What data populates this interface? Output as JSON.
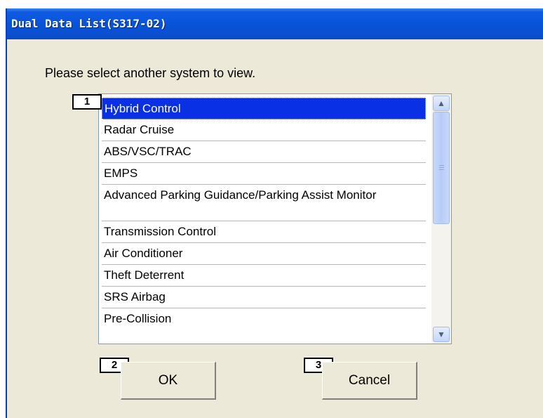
{
  "window": {
    "title": "Dual Data List(S317-02)"
  },
  "instruction": "Please select another system to view.",
  "systems": [
    {
      "label": "Hybrid Control",
      "selected": true
    },
    {
      "label": "Radar Cruise",
      "selected": false
    },
    {
      "label": "ABS/VSC/TRAC",
      "selected": false
    },
    {
      "label": "EMPS",
      "selected": false
    },
    {
      "label": "Advanced Parking Guidance/Parking Assist Monitor",
      "selected": false
    },
    {
      "label": "Transmission Control",
      "selected": false
    },
    {
      "label": "Air Conditioner",
      "selected": false
    },
    {
      "label": "Theft Deterrent",
      "selected": false
    },
    {
      "label": "SRS Airbag",
      "selected": false
    },
    {
      "label": "Pre-Collision",
      "selected": false
    }
  ],
  "callouts": {
    "list": "1",
    "ok": "2",
    "cancel": "3"
  },
  "buttons": {
    "ok": "OK",
    "cancel": "Cancel"
  },
  "icons": {
    "scroll_up": "chevron-up-icon",
    "scroll_down": "chevron-down-icon"
  },
  "colors": {
    "titlebar": "#0853d8",
    "selection": "#0a30e6",
    "dialog_bg": "#ece9d8"
  }
}
